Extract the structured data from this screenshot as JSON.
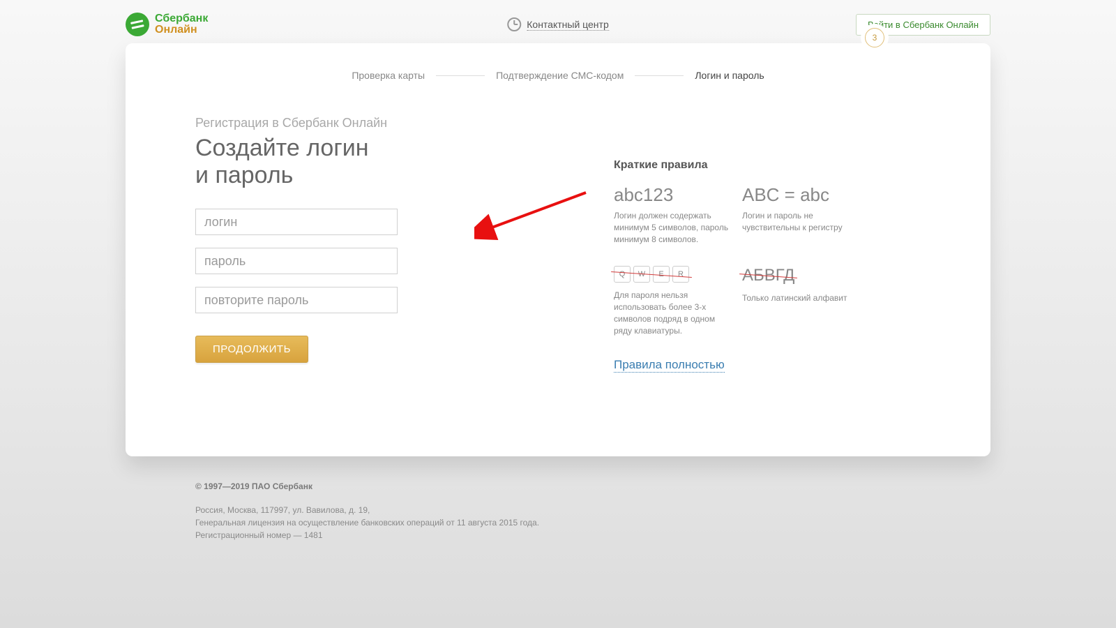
{
  "brand": {
    "line1": "Сбербанк",
    "line2": "Онлайн"
  },
  "header": {
    "contact_label": "Контактный центр",
    "login_button": "Войти в Сбербанк Онлайн"
  },
  "steps": {
    "items": [
      "Проверка карты",
      "Подтверждение СМС-кодом",
      "Логин и пароль"
    ],
    "current_number": "3"
  },
  "form": {
    "subtitle": "Регистрация в Сбербанк Онлайн",
    "title_line1": "Создайте логин",
    "title_line2": "и пароль",
    "login_placeholder": "логин",
    "password_placeholder": "пароль",
    "password2_placeholder": "повторите пароль",
    "continue": "ПРОДОЛЖИТЬ"
  },
  "rules": {
    "heading": "Краткие правила",
    "r1_head": "abc123",
    "r1_text": "Логин должен содержать минимум 5 символов, пароль минимум 8 символов.",
    "r2_head": "ABC = abc",
    "r2_text": "Логин и пароль не чувствительны к регистру",
    "r3_keys": [
      "Q",
      "W",
      "E",
      "R"
    ],
    "r3_text": "Для пароля нельзя использовать более 3-х символов подряд в одном ряду клавиатуры.",
    "r4_head": "АБВГД",
    "r4_text": "Только латинский алфавит",
    "full_link": "Правила полностью"
  },
  "footer": {
    "copyright": "© 1997—2019 ПАО Сбербанк",
    "addr": "Россия, Москва, 117997, ул. Вавилова, д. 19,",
    "license": "Генеральная лицензия на осуществление банковских операций от 11 августа 2015 года.",
    "reg": "Регистрационный номер — 1481"
  }
}
